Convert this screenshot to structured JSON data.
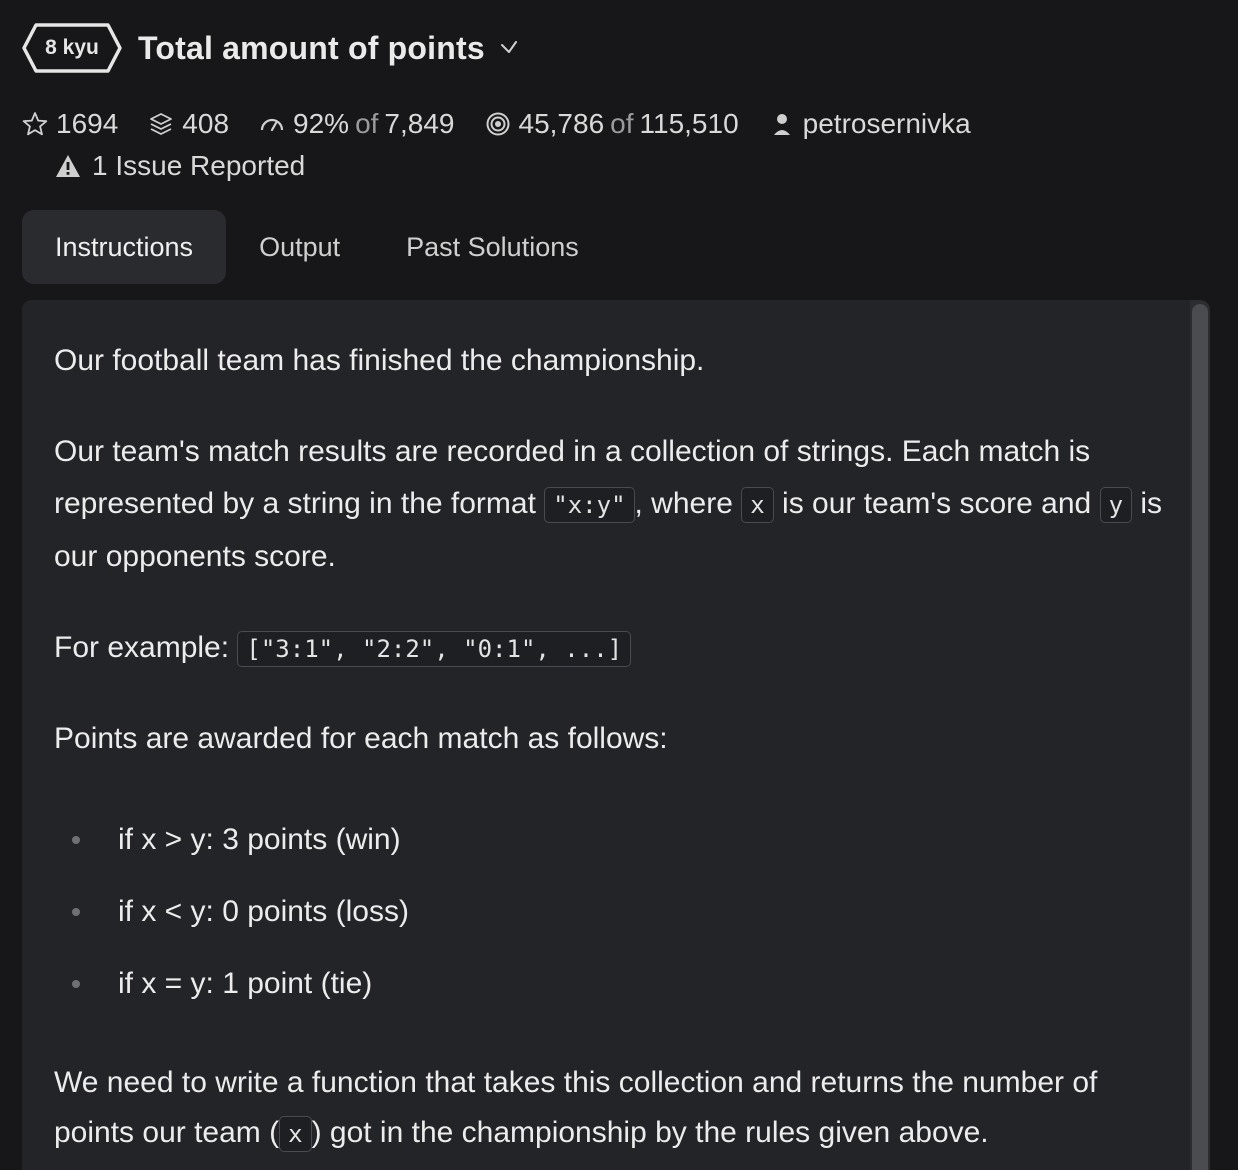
{
  "header": {
    "rank": "8 kyu",
    "title": "Total amount of points"
  },
  "stats": {
    "stars": "1694",
    "collections": "408",
    "satisfaction_pct": "92%",
    "satisfaction_of": "of",
    "satisfaction_votes": "7,849",
    "completed": "45,786",
    "completed_of": "of",
    "attempted": "115,510",
    "author": "petrosernivka",
    "issues": "1 Issue Reported"
  },
  "tabs": [
    {
      "label": "Instructions",
      "active": true
    },
    {
      "label": "Output",
      "active": false
    },
    {
      "label": "Past Solutions",
      "active": false
    }
  ],
  "instructions": {
    "p1": "Our football team has finished the championship.",
    "p2_a": "Our team's match results are recorded in a collection of strings. Each match is represented by a string in the format ",
    "p2_code1": "\"x:y\"",
    "p2_b": ", where ",
    "p2_code2": "x",
    "p2_c": " is our team's score and ",
    "p2_code3": "y",
    "p2_d": " is our opponents score.",
    "p3_label": "For example: ",
    "p3_code": "[\"3:1\", \"2:2\", \"0:1\", ...]",
    "p4": "Points are awarded for each match as follows:",
    "rules": [
      "if x > y: 3 points (win)",
      "if x < y: 0 points (loss)",
      "if x = y: 1 point (tie)"
    ],
    "p5_a": "We need to write a function that takes this collection and returns the number of points our team (",
    "p5_code": "x",
    "p5_b": ") got in the championship by the rules given above."
  },
  "icons": {
    "star": "star-outline-icon",
    "collections": "layers-icon",
    "satisfaction": "gauge-icon",
    "completed": "target-icon",
    "author": "user-icon",
    "issue": "warning-icon",
    "title_check": "chevron-down-icon"
  }
}
